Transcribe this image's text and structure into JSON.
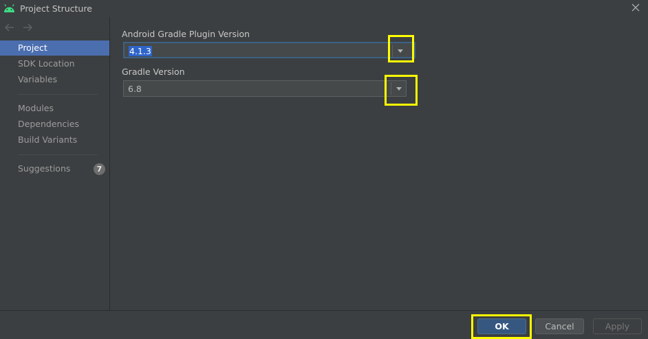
{
  "window": {
    "title": "Project Structure"
  },
  "sidebar": {
    "items": [
      {
        "label": "Project"
      },
      {
        "label": "SDK Location"
      },
      {
        "label": "Variables"
      },
      {
        "label": "Modules"
      },
      {
        "label": "Dependencies"
      },
      {
        "label": "Build Variants"
      },
      {
        "label": "Suggestions",
        "badge": "7"
      }
    ]
  },
  "main": {
    "agp": {
      "label": "Android Gradle Plugin Version",
      "value": "4.1.3"
    },
    "gradle": {
      "label": "Gradle Version",
      "value": "6.8"
    }
  },
  "footer": {
    "ok_label": "OK",
    "cancel_label": "Cancel",
    "apply_label": "Apply"
  },
  "colors": {
    "accent": "#4b6eaf",
    "highlight": "#ffff00",
    "android_green": "#3ddc84"
  }
}
